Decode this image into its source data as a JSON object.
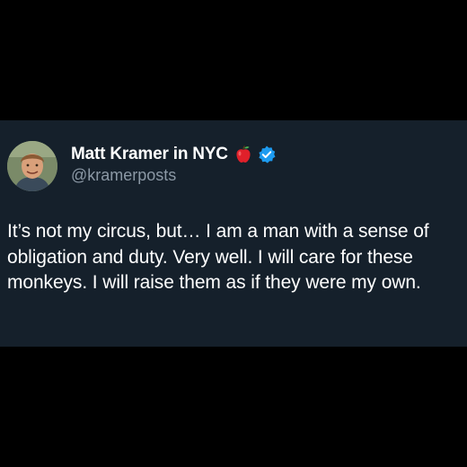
{
  "tweet": {
    "display_name": "Matt Kramer in NYC",
    "name_emoji": "apple-emoji",
    "verified": "verified-badge-icon",
    "handle": "@kramerposts",
    "text": "It’s not my circus, but… I am a man with a sense of obligation and duty. Very well. I will care for these monkeys. I will raise them as if they were my own."
  },
  "colors": {
    "page_background": "#000000",
    "card_background": "#15202b",
    "text_primary": "#ffffff",
    "text_secondary": "#8b98a5",
    "verified_blue": "#1d9bf0",
    "apple_red": "#e0202a"
  }
}
